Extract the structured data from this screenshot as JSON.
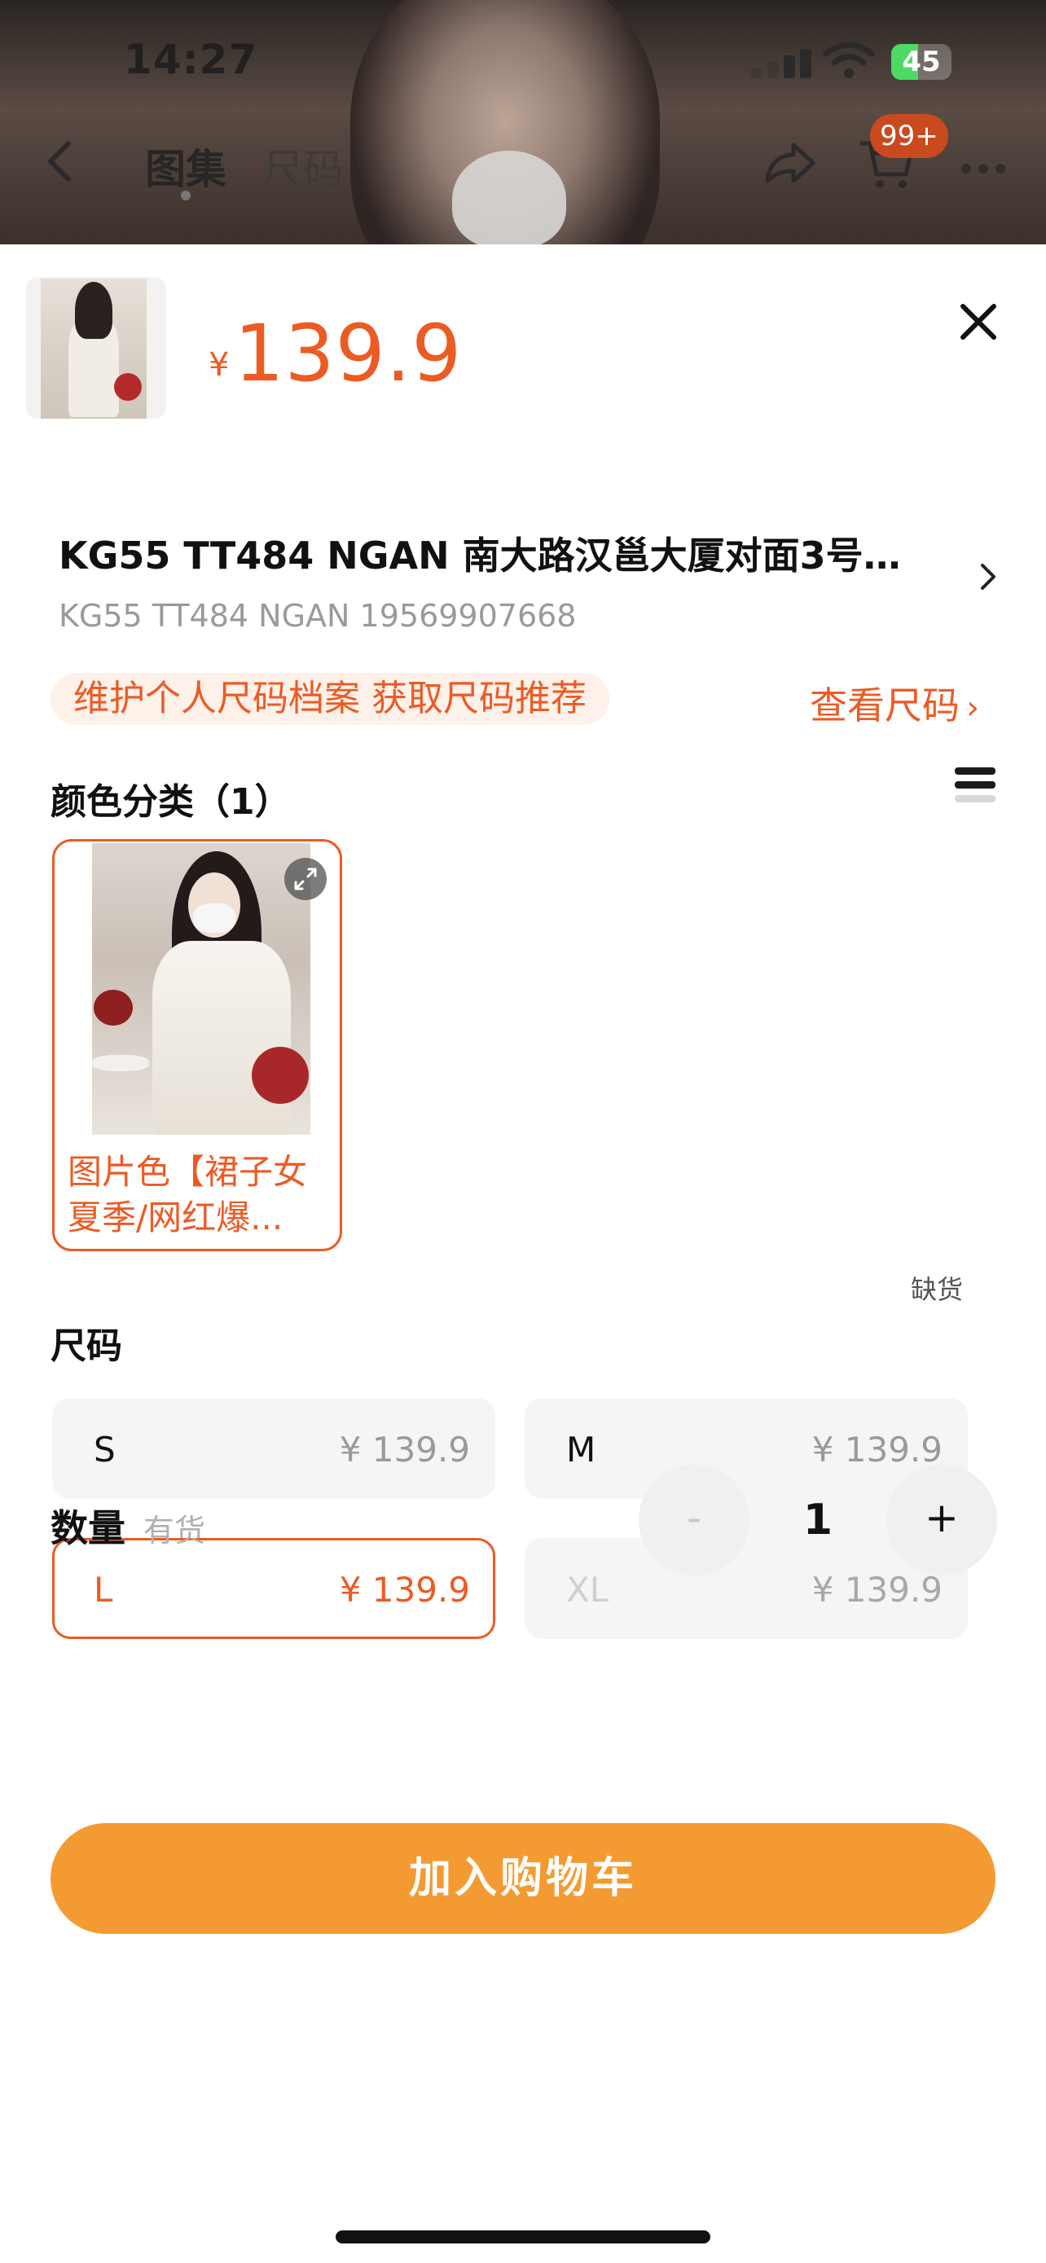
{
  "status_bar": {
    "time": "14:27",
    "battery": "45",
    "battery_level": 0.45
  },
  "nav": {
    "tabs": [
      "图集",
      "尺码"
    ],
    "cart_badge": "99+"
  },
  "product": {
    "currency": "¥",
    "price": "139.9",
    "shop_title": "KG55 TT484 NGAN 南大路汉邕大厦对面3号仓...",
    "shop_sub": "KG55 TT484 NGAN 19569907668"
  },
  "size_tip": {
    "text": "维护个人尺码档案 获取尺码推荐",
    "link": "查看尺码",
    "link_arrow": "›"
  },
  "color_section": {
    "title": "颜色分类（1）",
    "option_label": "图片色【裙子女夏季/网红爆..."
  },
  "size_section": {
    "title": "尺码",
    "options": [
      {
        "name": "S",
        "price": "¥ 139.9"
      },
      {
        "name": "M",
        "price": "¥ 139.9"
      },
      {
        "name": "L",
        "price": "¥ 139.9"
      },
      {
        "name": "XL",
        "price": "¥ 139.9"
      }
    ],
    "selected": "L",
    "out_of_stock_tag": "缺货"
  },
  "quantity": {
    "label": "数量",
    "stock": "有货",
    "minus": "-",
    "value": "1",
    "plus": "+"
  },
  "actions": {
    "add_to_cart": "加入购物车"
  },
  "colors": {
    "accent": "#ec5b24",
    "button": "#f39b32"
  }
}
